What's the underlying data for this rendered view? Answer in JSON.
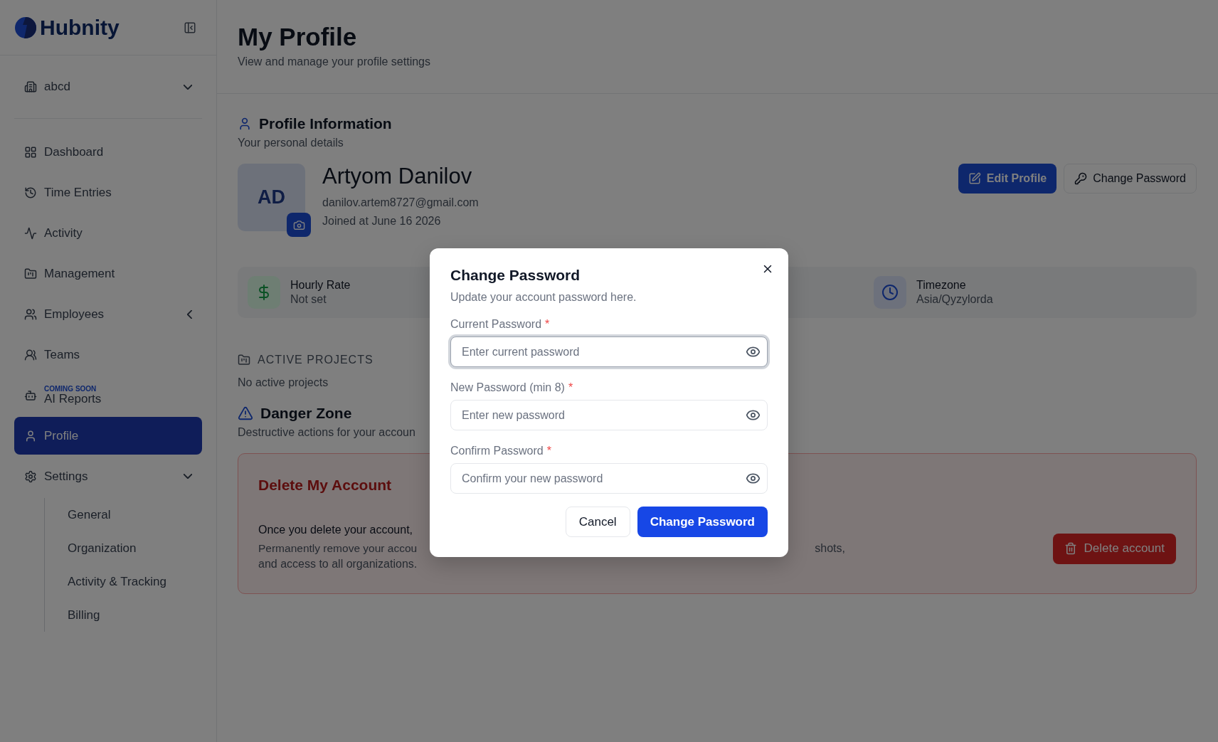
{
  "sidebar": {
    "brand": "Hubnity",
    "workspace": "abcd",
    "items": [
      {
        "label": "Dashboard",
        "selected": false
      },
      {
        "label": "Time Entries",
        "selected": false
      },
      {
        "label": "Activity",
        "selected": false
      },
      {
        "label": "Management",
        "selected": false
      },
      {
        "label": "Employees",
        "selected": false,
        "expanded": false
      },
      {
        "label": "Teams",
        "selected": false
      },
      {
        "label": "AI Reports",
        "selected": false,
        "badge": "COMING SOON"
      },
      {
        "label": "Profile",
        "selected": true
      },
      {
        "label": "Settings",
        "selected": false,
        "expanded": true,
        "children": [
          {
            "label": "General"
          },
          {
            "label": "Organization"
          },
          {
            "label": "Activity & Tracking"
          },
          {
            "label": "Billing"
          }
        ]
      }
    ]
  },
  "header": {
    "title": "My Profile",
    "subtitle": "View and manage your profile settings"
  },
  "profile": {
    "title": "Profile Information",
    "subtitle": "Your personal details",
    "initials": "AD",
    "name": "Artyom Danilov",
    "email": "danilov.artem8727@gmail.com",
    "joined": "Joined at June 16 2026",
    "actions": [
      {
        "label": "Edit Profile",
        "kind": "primary"
      },
      {
        "label": "Change Password",
        "kind": "outline"
      }
    ]
  },
  "stats": [
    {
      "label": "Hourly Rate",
      "value": "Not set"
    },
    {
      "label": "Timezone",
      "value": "Asia/Qyzylorda"
    }
  ],
  "projects": {
    "title": "ACTIVE PROJECTS",
    "empty": "No active projects"
  },
  "danger": {
    "title": "Danger Zone",
    "subtitle": "Destructive actions for your accoun",
    "card_title": "Delete My Account",
    "lead": "Once you delete your account,",
    "body_start": "Permanently remove your accou",
    "body_end": "shots,",
    "body_line2": "and access to all organizations.",
    "button": "Delete account"
  },
  "dialog": {
    "title": "Change Password",
    "subtitle": "Update your account password here.",
    "fields": [
      {
        "label": "Current Password",
        "mark": "*",
        "placeholder": "Enter current password",
        "focused": true
      },
      {
        "label": "New Password (min 8)",
        "mark": "*",
        "placeholder": "Enter new password",
        "focused": false
      },
      {
        "label": "Confirm Password",
        "mark": "*",
        "placeholder": "Confirm your new password",
        "focused": false
      }
    ],
    "buttons": [
      {
        "label": "Cancel",
        "kind": "secondary"
      },
      {
        "label": "Change Password",
        "kind": "primary"
      }
    ]
  }
}
